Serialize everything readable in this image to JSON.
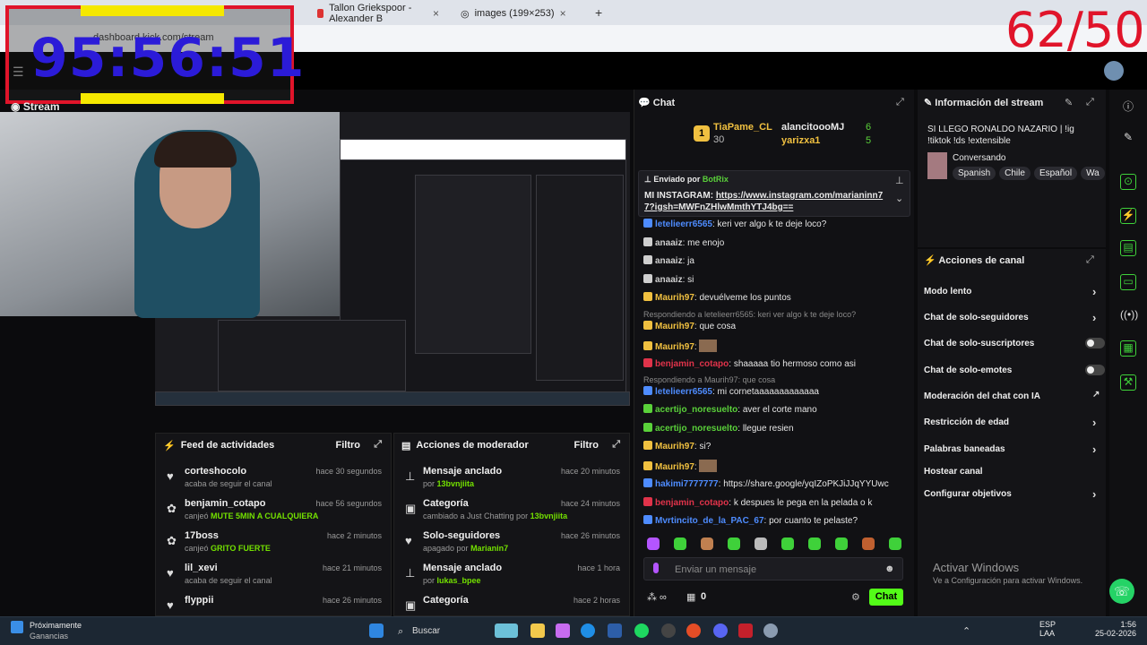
{
  "browser": {
    "tabs": [
      {
        "label": "Tallon Griekspoor - Alexander B"
      },
      {
        "label": "images (199×253)"
      }
    ],
    "url": "dashboard.kick.com/stream"
  },
  "overlay": {
    "timer": "95:56:51",
    "counter": "62/50"
  },
  "stream": {
    "header": "Stream"
  },
  "activity_feed": {
    "title": "Feed de actividades",
    "filter": "Filtro",
    "items": [
      {
        "icon": "heart-icon",
        "user": "corteshocolo",
        "sub": "acaba de seguir el canal",
        "highlight": "",
        "time": "hace 30 segundos"
      },
      {
        "icon": "gift-icon",
        "user": "benjamin_cotapo",
        "sub": "canjeó",
        "highlight": "MUTE 5MIN A CUALQUIERA",
        "time": "hace 56 segundos"
      },
      {
        "icon": "gift-icon",
        "user": "17boss",
        "sub": "canjeó",
        "highlight": "GRITO FUERTE",
        "time": "hace 2 minutos"
      },
      {
        "icon": "heart-icon",
        "user": "lil_xevi",
        "sub": "acaba de seguir el canal",
        "highlight": "",
        "time": "hace 21 minutos"
      },
      {
        "icon": "heart-icon",
        "user": "flyppii",
        "sub": "",
        "highlight": "",
        "time": "hace 26 minutos"
      }
    ]
  },
  "mod_actions": {
    "title": "Acciones de moderador",
    "filter": "Filtro",
    "items": [
      {
        "icon": "pin-icon",
        "title": "Mensaje anclado",
        "sub": "por",
        "who": "13bvnjiita",
        "time": "hace 20 minutos"
      },
      {
        "icon": "category-icon",
        "title": "Categoría",
        "sub": "cambiado a Just Chatting por",
        "who": "13bvnjiita",
        "time": "hace 24 minutos"
      },
      {
        "icon": "heart-icon",
        "title": "Solo-seguidores",
        "sub": "apagado por",
        "who": "Marianin7",
        "time": "hace 26 minutos"
      },
      {
        "icon": "pin-icon",
        "title": "Mensaje anclado",
        "sub": "por",
        "who": "lukas_bpee",
        "time": "hace 1 hora"
      },
      {
        "icon": "category-icon",
        "title": "Categoría",
        "sub": "",
        "who": "",
        "time": "hace 2 horas"
      }
    ]
  },
  "chat": {
    "title": "Chat",
    "leaderboard": [
      {
        "rank": "1",
        "user": "TiaPame_CL",
        "count": "30"
      },
      {
        "rank": "",
        "user": "alancitoooMJ",
        "count": "6"
      },
      {
        "rank": "",
        "user": "yarizxa1",
        "count": "5"
      }
    ],
    "pinned": {
      "label": "Enviado por",
      "by": "BotRix",
      "text": "MI INSTAGRAM:",
      "link": "https://www.instagram.com/marianinn77?igsh=MWFnZHlwMmthYTJ4bg=="
    },
    "messages": [
      {
        "user": "letelieerr6565",
        "color": "#4e8cff",
        "text": "keri ver algo k te deje loco?",
        "reply": ""
      },
      {
        "user": "anaaiz",
        "color": "#cfcfcf",
        "text": "me enojo",
        "reply": ""
      },
      {
        "user": "anaaiz",
        "color": "#cfcfcf",
        "text": "ja",
        "reply": ""
      },
      {
        "user": "anaaiz",
        "color": "#cfcfcf",
        "text": "si",
        "reply": ""
      },
      {
        "user": "Maurih97",
        "color": "#f0c040",
        "text": "devuélveme los puntos",
        "reply": ""
      },
      {
        "user": "Maurih97",
        "color": "#f0c040",
        "text": "que cosa",
        "reply": "Respondiendo a letelieerr6565: keri ver algo k te deje loco?"
      },
      {
        "user": "Maurih97",
        "color": "#f0c040",
        "text": "",
        "reply": ""
      },
      {
        "user": "benjamin_cotapo",
        "color": "#e0334a",
        "text": "shaaaaa tio hermoso como asi",
        "reply": ""
      },
      {
        "user": "letelieerr6565",
        "color": "#4e8cff",
        "text": "mi cornetaaaaaaaaaaaaa",
        "reply": "Respondiendo a Maurih97: que cosa"
      },
      {
        "user": "acertijo_noresuelto",
        "color": "#5ad13a",
        "text": "aver el corte mano",
        "reply": ""
      },
      {
        "user": "acertijo_noresuelto",
        "color": "#5ad13a",
        "text": "llegue resien",
        "reply": ""
      },
      {
        "user": "Maurih97",
        "color": "#f0c040",
        "text": "si?",
        "reply": ""
      },
      {
        "user": "Maurih97",
        "color": "#f0c040",
        "text": "",
        "reply": ""
      },
      {
        "user": "hakimi7777777",
        "color": "#4e8cff",
        "text": "https://share.google/yqIZoPKJiJJqYYUwc",
        "reply": ""
      },
      {
        "user": "benjamin_cotapo",
        "color": "#e0334a",
        "text": "k despues le pega en la pelada o k",
        "reply": ""
      },
      {
        "user": "Mvrtincito_de_la_PAC_67",
        "color": "#4e8cff",
        "text": "por cuanto te pelaste?",
        "reply": ""
      }
    ],
    "input_placeholder": "Enviar un mensaje",
    "points": "0",
    "send": "Chat"
  },
  "stream_info": {
    "title": "Información del stream",
    "stream_title": "SI LLEGO RONALDO NAZARIO | !ig !tiktok !ds !extensible",
    "category": "Conversando",
    "tags": [
      "Spanish",
      "Chile",
      "Español",
      "Wa"
    ]
  },
  "channel_actions": {
    "title": "Acciones de canal",
    "items": [
      {
        "label": "Modo lento",
        "control": "chevron"
      },
      {
        "label": "Chat de solo-seguidores",
        "control": "chevron"
      },
      {
        "label": "Chat de solo-suscriptores",
        "control": "toggle"
      },
      {
        "label": "Chat de solo-emotes",
        "control": "toggle"
      },
      {
        "label": "Moderación del chat con IA",
        "control": "external"
      },
      {
        "label": "Restricción de edad",
        "control": "chevron"
      },
      {
        "label": "Palabras baneadas",
        "control": "chevron"
      },
      {
        "label": "Hostear canal",
        "control": "none"
      },
      {
        "label": "Configurar objetivos",
        "control": "chevron"
      }
    ]
  },
  "watermark": {
    "line1": "Activar Windows",
    "line2": "Ve a Configuración para activar Windows."
  },
  "taskbar": {
    "weather_title": "Próximamente",
    "weather_sub": "Ganancias",
    "search": "Buscar",
    "lang": "ESP",
    "lang2": "LAA",
    "time": "1:56",
    "date": "25-02-2026"
  }
}
